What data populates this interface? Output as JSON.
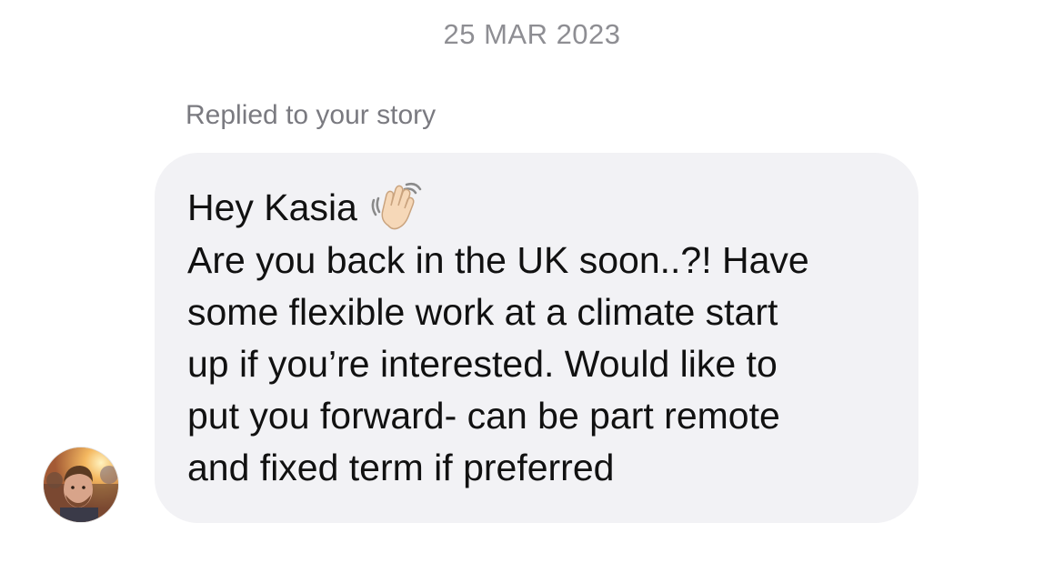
{
  "header": {
    "date": "25 MAR 2023"
  },
  "message": {
    "reply_context": "Replied to your story",
    "greeting": "Hey Kasia",
    "greeting_emoji": "waving-hand-icon",
    "body_lines": [
      "Are you back in the UK soon..?! Have",
      "some flexible work at a climate start",
      "up if you’re interested. Would like to",
      "put you forward- can be part remote",
      "and fixed term if preferred"
    ],
    "bubble_color": "#f2f2f5"
  },
  "sender": {
    "avatar": "avatar"
  }
}
